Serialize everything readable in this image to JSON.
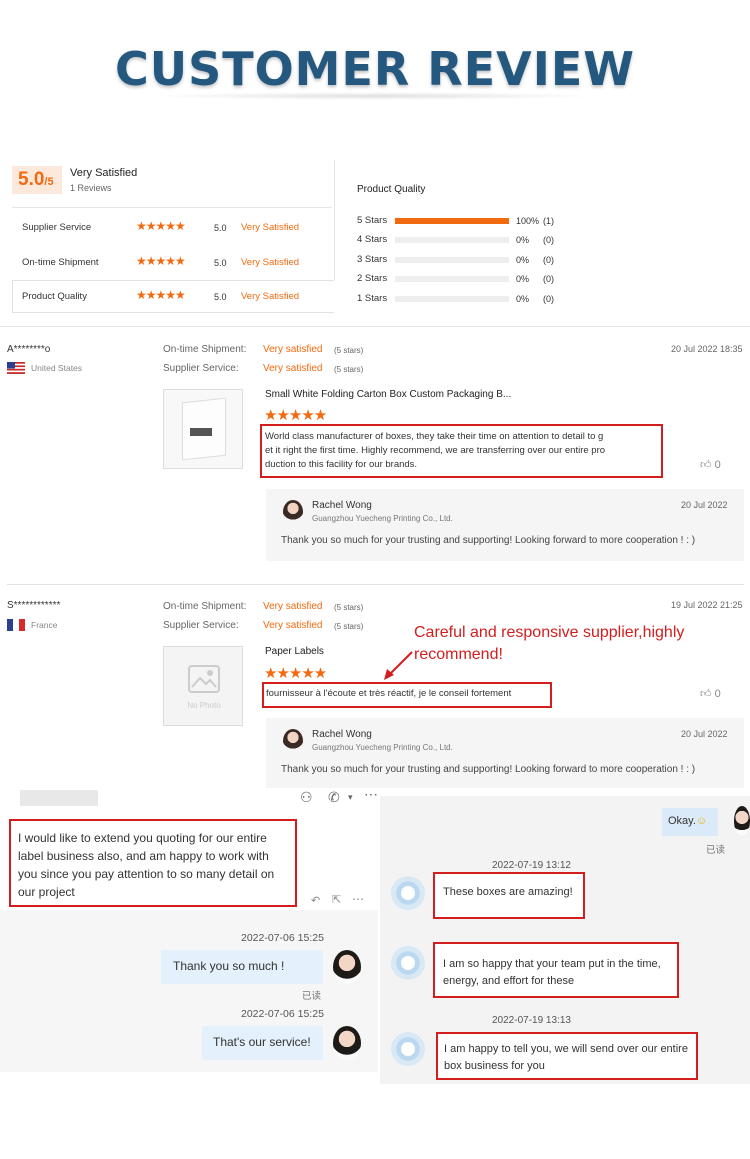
{
  "page": {
    "title": "CUSTOMER REVIEW"
  },
  "summary": {
    "score": "5.0",
    "score_suffix": "/5",
    "label": "Very Satisfied",
    "reviews": "1 Reviews",
    "metrics": [
      {
        "label": "Supplier Service",
        "value": "5.0",
        "rating": "Very Satisfied",
        "stars": 5
      },
      {
        "label": "On-time Shipment",
        "value": "5.0",
        "rating": "Very Satisfied",
        "stars": 5
      },
      {
        "label": "Product Quality",
        "value": "5.0",
        "rating": "Very Satisfied",
        "stars": 5
      }
    ],
    "pq_title": "Product Quality",
    "distribution": [
      {
        "label": "5 Stars",
        "percent": "100%",
        "count": "(1)",
        "fill": 1.0
      },
      {
        "label": "4 Stars",
        "percent": "0%",
        "count": "(0)",
        "fill": 0
      },
      {
        "label": "3 Stars",
        "percent": "0%",
        "count": "(0)",
        "fill": 0
      },
      {
        "label": "2 Stars",
        "percent": "0%",
        "count": "(0)",
        "fill": 0
      },
      {
        "label": "1 Stars",
        "percent": "0%",
        "count": "(0)",
        "fill": 0
      }
    ]
  },
  "reviews": [
    {
      "name": "A********o",
      "country": "United States",
      "date": "20 Jul 2022 18:35",
      "shipment_label": "On-time Shipment:",
      "shipment_value": "Very satisfied",
      "shipment_stars": "(5 stars)",
      "service_label": "Supplier Service:",
      "service_value": "Very satisfied",
      "service_stars": "(5 stars)",
      "product": "Small White Folding Carton Box Custom Packaging B...",
      "text_lines": [
        "World class manufacturer of boxes, they take their time on attention to detail to g",
        "et it right the first time.  Highly recommend, we are transferring over our entire pro",
        "duction to this facility for our brands."
      ],
      "likes": "0",
      "reply": {
        "name": "Rachel Wong",
        "org": "Guangzhou Yuecheng Printing Co., Ltd.",
        "date": "20 Jul 2022",
        "text": "Thank you so much for your trusting and supporting! Looking forward to more cooperation ! : )"
      }
    },
    {
      "name": "S************",
      "country": "France",
      "date": "19 Jul 2022 21:25",
      "shipment_label": "On-time Shipment:",
      "shipment_value": "Very satisfied",
      "shipment_stars": "(5 stars)",
      "service_label": "Supplier Service:",
      "service_value": "Very satisfied",
      "service_stars": "(5 stars)",
      "product": "Paper Labels",
      "no_photo": "No Photo",
      "text_lines": [
        "fournisseur à l'écoute et très réactif, je le conseil fortement"
      ],
      "likes": "0",
      "reply": {
        "name": "Rachel Wong",
        "org": "Guangzhou Yuecheng Printing Co., Ltd.",
        "date": "20 Jul 2022",
        "text": "Thank you so much for your trusting and supporting! Looking forward to more cooperation ! : )"
      }
    }
  ],
  "annotation": {
    "line1": "Careful and responsive supplier,highly",
    "line2": "recommend!"
  },
  "chat_left": {
    "message_lines": [
      "I would like to extend you quoting for our entire",
      "label business also, and am happy to work with",
      "you since you pay attention to so many detail on",
      "our project"
    ],
    "time1": "2022-07-06 15:25",
    "bubble1": "Thank you so much !",
    "read": "已读",
    "time2": "2022-07-06 15:25",
    "bubble2": "That's our service!"
  },
  "chat_right": {
    "okay": "Okay.",
    "read": "已读",
    "time1": "2022-07-19 13:12",
    "msg1": "These boxes are amazing!",
    "msg2_lines": [
      "I am so happy that your team put in the time,",
      "energy, and effort for these"
    ],
    "time2": "2022-07-19 13:13",
    "msg3_lines": [
      "I am happy to tell you, we will send over our entire",
      "box business for you"
    ]
  }
}
